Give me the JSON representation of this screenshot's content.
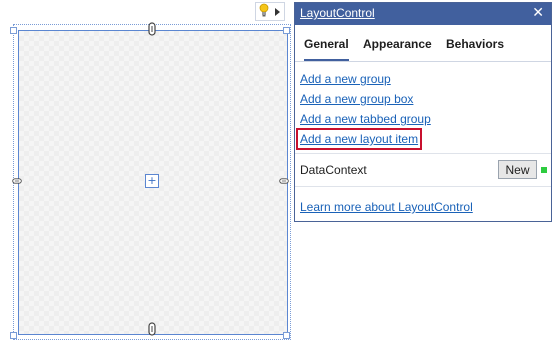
{
  "panel": {
    "title": "LayoutControl",
    "close_glyph": "✕",
    "tabs": [
      {
        "label": "General",
        "active": true
      },
      {
        "label": "Appearance",
        "active": false
      },
      {
        "label": "Behaviors",
        "active": false
      }
    ],
    "links": [
      {
        "label": "Add a new group",
        "highlighted": false
      },
      {
        "label": "Add a new group box",
        "highlighted": false
      },
      {
        "label": "Add a new tabbed group",
        "highlighted": false
      },
      {
        "label": "Add a new layout item",
        "highlighted": true
      }
    ],
    "property": {
      "label": "DataContext",
      "button_label": "New",
      "status_color": "#2ecc40"
    },
    "learn_more": "Learn more about LayoutControl"
  },
  "designer": {
    "add_item_glyph": "+",
    "smart_tag_icon": "lightbulb-icon"
  },
  "colors": {
    "accent": "#41609e",
    "link": "#1a62b8",
    "highlight_border": "#c8102e",
    "selection": "#5b86d1"
  }
}
